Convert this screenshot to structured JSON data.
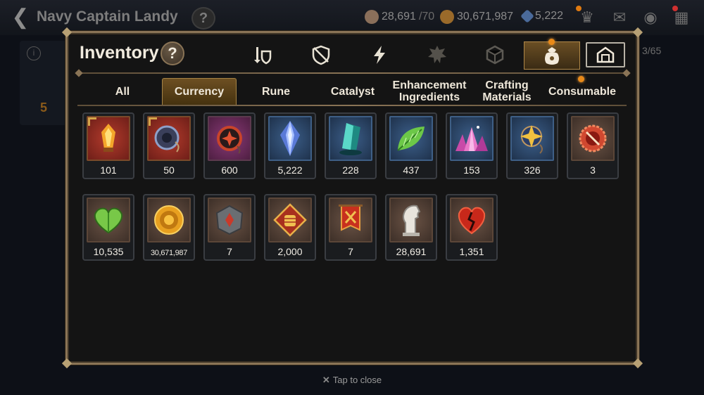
{
  "background": {
    "title": "Navy Captain Landy",
    "help_label": "?",
    "resources": [
      {
        "name": "stamina",
        "value": "28,691",
        "max": "/70",
        "icon": "stamina-icon",
        "color": "#8a6f5a"
      },
      {
        "name": "gold",
        "value": "30,671,987",
        "icon": "gold-coin-icon",
        "color": "#9a6a2a"
      },
      {
        "name": "crystal",
        "value": "5,222",
        "icon": "crystal-icon",
        "color": "#4a6a9a"
      }
    ],
    "inventory_count": "3/65",
    "left_number": "5"
  },
  "modal": {
    "title": "Inventory",
    "help_label": "?",
    "category_icons": [
      {
        "name": "weapon-equipment-icon"
      },
      {
        "name": "armor-shield-icon"
      },
      {
        "name": "artifact-lightning-icon"
      },
      {
        "name": "rune-icon"
      },
      {
        "name": "cube-material-icon"
      },
      {
        "name": "currency-bag-icon",
        "active": true
      },
      {
        "name": "storage-house-icon"
      }
    ],
    "sub_tabs": [
      "All",
      "Currency",
      "Rune",
      "Catalyst",
      "Enhancement Ingredients",
      "Crafting Materials",
      "Consumable"
    ],
    "active_sub_tab": "Currency",
    "items": [
      {
        "icon": "flame-crystal-icon",
        "qty": "101",
        "rarity": "red"
      },
      {
        "icon": "bond-token-icon",
        "qty": "50",
        "rarity": "red"
      },
      {
        "icon": "red-medal-icon",
        "qty": "600",
        "rarity": "purple"
      },
      {
        "icon": "blue-crystal-gem-icon",
        "qty": "5,222",
        "rarity": "blue"
      },
      {
        "icon": "teal-crystal-icon",
        "qty": "228",
        "rarity": "blue"
      },
      {
        "icon": "green-leaf-icon",
        "qty": "437",
        "rarity": "blue"
      },
      {
        "icon": "pink-crystal-cluster-icon",
        "qty": "153",
        "rarity": "blue"
      },
      {
        "icon": "star-amulet-icon",
        "qty": "326",
        "rarity": "blue"
      },
      {
        "icon": "forbidden-seal-icon",
        "qty": "3",
        "rarity": "brown"
      },
      {
        "icon": "green-heart-icon",
        "qty": "10,535",
        "rarity": "brown"
      },
      {
        "icon": "gold-sun-coin-icon",
        "qty": "30,671,987",
        "rarity": "brown"
      },
      {
        "icon": "stone-emblem-icon",
        "qty": "7",
        "rarity": "brown"
      },
      {
        "icon": "fist-emblem-icon",
        "qty": "2,000",
        "rarity": "brown"
      },
      {
        "icon": "war-banner-icon",
        "qty": "7",
        "rarity": "brown"
      },
      {
        "icon": "horse-head-icon",
        "qty": "28,691",
        "rarity": "brown"
      },
      {
        "icon": "broken-heart-emblem-icon",
        "qty": "1,351",
        "rarity": "brown"
      }
    ],
    "close_hint": "Tap to close"
  }
}
